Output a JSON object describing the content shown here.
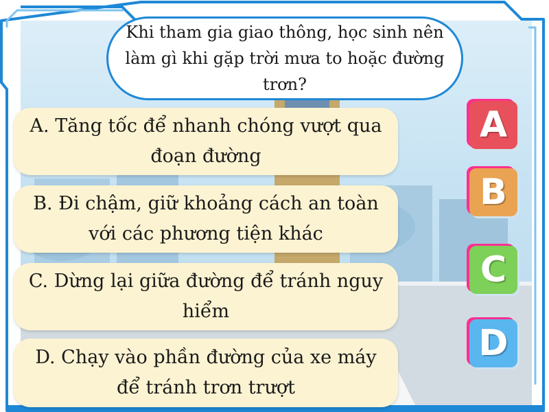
{
  "question": "Khi tham gia giao thông, học sinh nên làm gì khi gặp trời mưa to hoặc đường trơn?",
  "answers": [
    {
      "letter": "A",
      "text": "A. Tăng tốc để nhanh chóng vượt qua đoạn đường",
      "color": "#e8505b"
    },
    {
      "letter": "B",
      "text": "B. Đi chậm, giữ khoảng cách an toàn với các phương tiện khác",
      "color": "#eaa352"
    },
    {
      "letter": "C",
      "text": "C. Dừng lại giữa đường để tránh nguy hiểm",
      "color": "#7dd058"
    },
    {
      "letter": "D",
      "text": "D. Chạy vào phần đường của xe máy để tránh trơn trượt",
      "color": "#5ab6ef"
    }
  ],
  "theme": {
    "frame_color": "#1e88d6",
    "answer_bg": "#fcf3d2",
    "button_glow": "#ff2f8e"
  }
}
